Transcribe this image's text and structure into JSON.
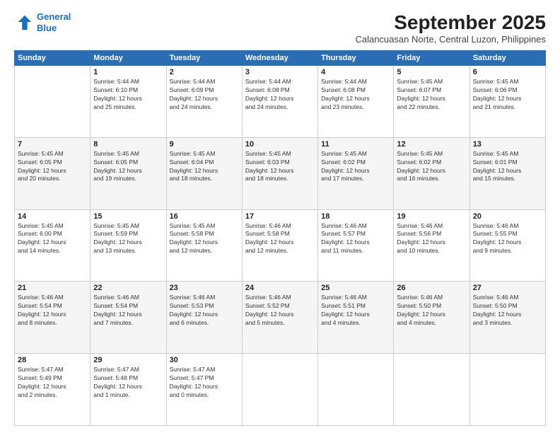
{
  "logo": {
    "line1": "General",
    "line2": "Blue"
  },
  "title": "September 2025",
  "subtitle": "Calancuasan Norte, Central Luzon, Philippines",
  "days_of_week": [
    "Sunday",
    "Monday",
    "Tuesday",
    "Wednesday",
    "Thursday",
    "Friday",
    "Saturday"
  ],
  "weeks": [
    [
      {
        "day": "",
        "info": ""
      },
      {
        "day": "1",
        "info": "Sunrise: 5:44 AM\nSunset: 6:10 PM\nDaylight: 12 hours\nand 25 minutes."
      },
      {
        "day": "2",
        "info": "Sunrise: 5:44 AM\nSunset: 6:09 PM\nDaylight: 12 hours\nand 24 minutes."
      },
      {
        "day": "3",
        "info": "Sunrise: 5:44 AM\nSunset: 6:08 PM\nDaylight: 12 hours\nand 24 minutes."
      },
      {
        "day": "4",
        "info": "Sunrise: 5:44 AM\nSunset: 6:08 PM\nDaylight: 12 hours\nand 23 minutes."
      },
      {
        "day": "5",
        "info": "Sunrise: 5:45 AM\nSunset: 6:07 PM\nDaylight: 12 hours\nand 22 minutes."
      },
      {
        "day": "6",
        "info": "Sunrise: 5:45 AM\nSunset: 6:06 PM\nDaylight: 12 hours\nand 21 minutes."
      }
    ],
    [
      {
        "day": "7",
        "info": "Sunrise: 5:45 AM\nSunset: 6:05 PM\nDaylight: 12 hours\nand 20 minutes."
      },
      {
        "day": "8",
        "info": "Sunrise: 5:45 AM\nSunset: 6:05 PM\nDaylight: 12 hours\nand 19 minutes."
      },
      {
        "day": "9",
        "info": "Sunrise: 5:45 AM\nSunset: 6:04 PM\nDaylight: 12 hours\nand 18 minutes."
      },
      {
        "day": "10",
        "info": "Sunrise: 5:45 AM\nSunset: 6:03 PM\nDaylight: 12 hours\nand 18 minutes."
      },
      {
        "day": "11",
        "info": "Sunrise: 5:45 AM\nSunset: 6:02 PM\nDaylight: 12 hours\nand 17 minutes."
      },
      {
        "day": "12",
        "info": "Sunrise: 5:45 AM\nSunset: 6:02 PM\nDaylight: 12 hours\nand 16 minutes."
      },
      {
        "day": "13",
        "info": "Sunrise: 5:45 AM\nSunset: 6:01 PM\nDaylight: 12 hours\nand 15 minutes."
      }
    ],
    [
      {
        "day": "14",
        "info": "Sunrise: 5:45 AM\nSunset: 6:00 PM\nDaylight: 12 hours\nand 14 minutes."
      },
      {
        "day": "15",
        "info": "Sunrise: 5:45 AM\nSunset: 5:59 PM\nDaylight: 12 hours\nand 13 minutes."
      },
      {
        "day": "16",
        "info": "Sunrise: 5:45 AM\nSunset: 5:58 PM\nDaylight: 12 hours\nand 12 minutes."
      },
      {
        "day": "17",
        "info": "Sunrise: 5:46 AM\nSunset: 5:58 PM\nDaylight: 12 hours\nand 12 minutes."
      },
      {
        "day": "18",
        "info": "Sunrise: 5:46 AM\nSunset: 5:57 PM\nDaylight: 12 hours\nand 11 minutes."
      },
      {
        "day": "19",
        "info": "Sunrise: 5:46 AM\nSunset: 5:56 PM\nDaylight: 12 hours\nand 10 minutes."
      },
      {
        "day": "20",
        "info": "Sunrise: 5:46 AM\nSunset: 5:55 PM\nDaylight: 12 hours\nand 9 minutes."
      }
    ],
    [
      {
        "day": "21",
        "info": "Sunrise: 5:46 AM\nSunset: 5:54 PM\nDaylight: 12 hours\nand 8 minutes."
      },
      {
        "day": "22",
        "info": "Sunrise: 5:46 AM\nSunset: 5:54 PM\nDaylight: 12 hours\nand 7 minutes."
      },
      {
        "day": "23",
        "info": "Sunrise: 5:46 AM\nSunset: 5:53 PM\nDaylight: 12 hours\nand 6 minutes."
      },
      {
        "day": "24",
        "info": "Sunrise: 5:46 AM\nSunset: 5:52 PM\nDaylight: 12 hours\nand 5 minutes."
      },
      {
        "day": "25",
        "info": "Sunrise: 5:46 AM\nSunset: 5:51 PM\nDaylight: 12 hours\nand 4 minutes."
      },
      {
        "day": "26",
        "info": "Sunrise: 5:46 AM\nSunset: 5:50 PM\nDaylight: 12 hours\nand 4 minutes."
      },
      {
        "day": "27",
        "info": "Sunrise: 5:46 AM\nSunset: 5:50 PM\nDaylight: 12 hours\nand 3 minutes."
      }
    ],
    [
      {
        "day": "28",
        "info": "Sunrise: 5:47 AM\nSunset: 5:49 PM\nDaylight: 12 hours\nand 2 minutes."
      },
      {
        "day": "29",
        "info": "Sunrise: 5:47 AM\nSunset: 5:48 PM\nDaylight: 12 hours\nand 1 minute."
      },
      {
        "day": "30",
        "info": "Sunrise: 5:47 AM\nSunset: 5:47 PM\nDaylight: 12 hours\nand 0 minutes."
      },
      {
        "day": "",
        "info": ""
      },
      {
        "day": "",
        "info": ""
      },
      {
        "day": "",
        "info": ""
      },
      {
        "day": "",
        "info": ""
      }
    ]
  ]
}
